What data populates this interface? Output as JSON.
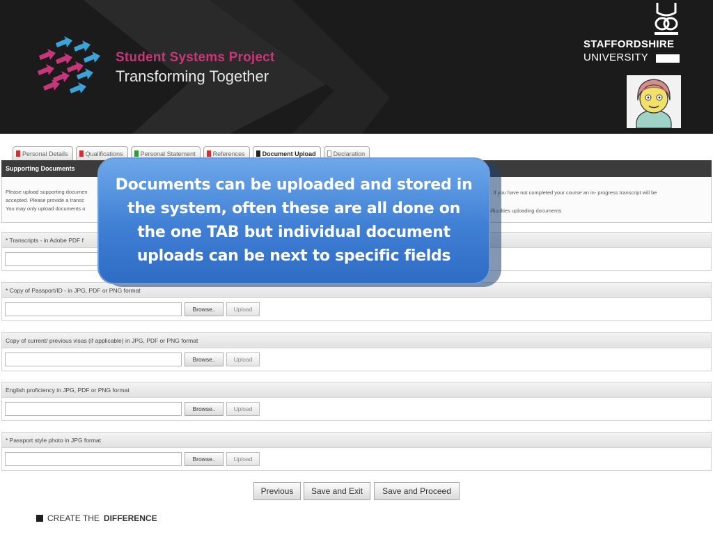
{
  "header": {
    "project_title": "Student Systems Project",
    "project_subtitle": "Transforming Together",
    "university_line1": "STAFFORDSHIRE",
    "university_line2": "UNIVERSITY",
    "logo_icon": "arrows-logo-icon",
    "crest_icon": "university-crest-icon",
    "avatar_icon": "student-avatar-icon",
    "colors": {
      "banner": "#1b1b1b",
      "title_pink": "#c8367a",
      "arrow_blue": "#3aa3d8"
    }
  },
  "tabs": [
    {
      "label": "Personal Details",
      "status_color": "#d03030",
      "active": false
    },
    {
      "label": "Qualifications",
      "status_color": "#d03030",
      "active": false
    },
    {
      "label": "Personal Statement",
      "status_color": "#2f9a3a",
      "active": false
    },
    {
      "label": "References",
      "status_color": "#d03030",
      "active": false
    },
    {
      "label": "Document Upload",
      "status_color": "#222222",
      "active": true
    },
    {
      "label": "Declaration",
      "status_color": "#ffffff",
      "active": false
    }
  ],
  "section": {
    "title": "Supporting Documents",
    "instructions_left": [
      "Please upload supporting documen",
      "accepted. Please provide a transc",
      "You may only upload documents o"
    ],
    "instructions_right_1": "n. If you have not completed your course an in- progress transcript will be",
    "instructions_right_2": "difficulties uploading documents"
  },
  "fields": [
    {
      "label": "* Transcripts - in Adobe PDF f",
      "browse": "",
      "upload": ""
    },
    {
      "label": "* Copy of Passport/ID - in JPG, PDF or PNG format",
      "browse": "Browse..",
      "upload": "Upload"
    },
    {
      "label": "Copy of current/ previous visas (if applicable) in JPG, PDF or PNG format",
      "browse": "Browse..",
      "upload": "Upload"
    },
    {
      "label": "English proficiency in JPG, PDF or PNG format",
      "browse": "Browse..",
      "upload": "Upload"
    },
    {
      "label": "* Passport style photo in JPG format",
      "browse": "Browse..",
      "upload": "Upload"
    }
  ],
  "nav": {
    "previous": "Previous",
    "save_exit": "Save and Exit",
    "save_proceed": "Save and Proceed"
  },
  "callout": {
    "text": "Documents can be uploaded and stored in the system, often these are all done on the one TAB but individual document uploads can be next to specific fields"
  },
  "footer": {
    "prefix": "CREATE THE",
    "strong": "DIFFERENCE"
  }
}
